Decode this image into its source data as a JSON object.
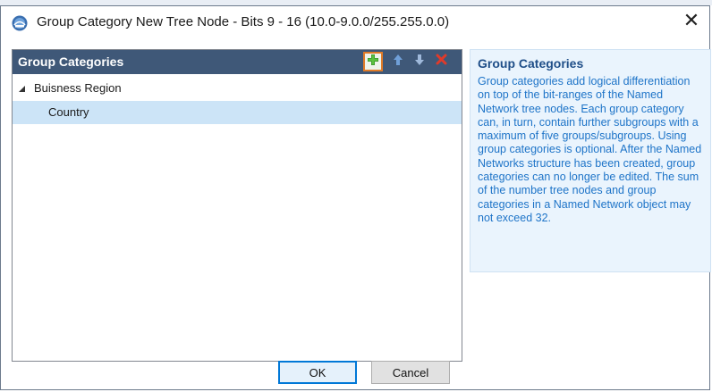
{
  "window": {
    "title": "Group Category New Tree Node - Bits 9 - 16 (10.0-9.0.0/255.255.0.0)",
    "close_symbol": "✕"
  },
  "tree": {
    "header_title": "Group Categories",
    "toolbar": {
      "add_icon": "plus-icon",
      "up_icon": "arrow-up-icon",
      "down_icon": "arrow-down-icon",
      "delete_icon": "x-delete-icon"
    },
    "nodes": [
      {
        "label": "Buisness Region",
        "expanded": true,
        "level": 0
      },
      {
        "label": "Country",
        "selected": true,
        "level": 1
      }
    ]
  },
  "help": {
    "title": "Group Categories",
    "text": "Group categories add logical differentiation on top of the bit-ranges of the Named Network tree nodes. Each group category can, in turn, contain further subgroups with a maximum of five groups/subgroups. Using group categories is optional. After the Named Networks structure has been created, group categories can no longer be edited. The sum of the number tree nodes and group categories in a Named Network object may not exceed 32."
  },
  "buttons": {
    "ok_label": "OK",
    "cancel_label": "Cancel"
  },
  "colors": {
    "header_bg": "#3f5878",
    "selection_bg": "#cce4f7",
    "help_bg": "#eaf4fd",
    "help_text": "#1e74c8",
    "add_highlight": "#e07b28"
  }
}
